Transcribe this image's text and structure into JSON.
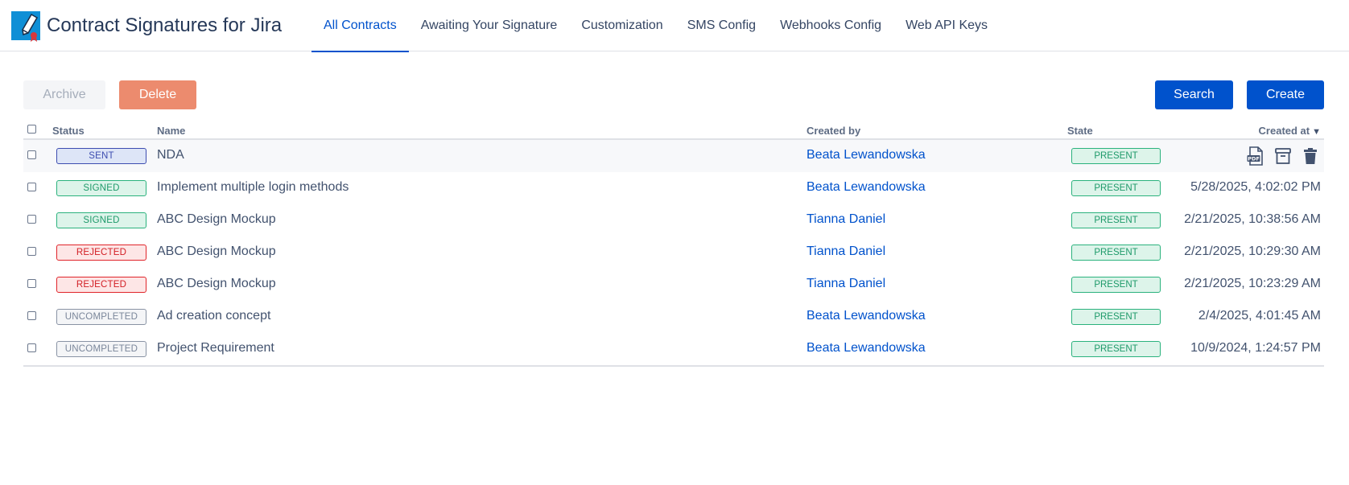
{
  "app": {
    "title": "Contract Signatures for Jira"
  },
  "nav": {
    "tabs": [
      {
        "label": "All Contracts",
        "active": true
      },
      {
        "label": "Awaiting Your Signature",
        "active": false
      },
      {
        "label": "Customization",
        "active": false
      },
      {
        "label": "SMS Config",
        "active": false
      },
      {
        "label": "Webhooks Config",
        "active": false
      },
      {
        "label": "Web API Keys",
        "active": false
      }
    ]
  },
  "toolbar": {
    "archive_label": "Archive",
    "delete_label": "Delete",
    "search_label": "Search",
    "create_label": "Create"
  },
  "table": {
    "headers": {
      "status": "Status",
      "name": "Name",
      "created_by": "Created by",
      "state": "State",
      "created_at": "Created at"
    },
    "sort_icon": "triangle-down-icon",
    "row_action_icons": [
      "pdf-file-icon",
      "archive-box-icon",
      "trash-icon"
    ],
    "rows": [
      {
        "status": "SENT",
        "status_kind": "sent",
        "name": "NDA",
        "created_by": "Beata Lewandowska",
        "state": "PRESENT",
        "created_at": "",
        "highlighted": true
      },
      {
        "status": "SIGNED",
        "status_kind": "signed",
        "name": "Implement multiple login methods",
        "created_by": "Beata Lewandowska",
        "state": "PRESENT",
        "created_at": "5/28/2025, 4:02:02 PM"
      },
      {
        "status": "SIGNED",
        "status_kind": "signed",
        "name": "ABC Design Mockup",
        "created_by": "Tianna Daniel",
        "state": "PRESENT",
        "created_at": "2/21/2025, 10:38:56 AM"
      },
      {
        "status": "REJECTED",
        "status_kind": "rejected",
        "name": "ABC Design Mockup",
        "created_by": "Tianna Daniel",
        "state": "PRESENT",
        "created_at": "2/21/2025, 10:29:30 AM"
      },
      {
        "status": "REJECTED",
        "status_kind": "rejected",
        "name": "ABC Design Mockup",
        "created_by": "Tianna Daniel",
        "state": "PRESENT",
        "created_at": "2/21/2025, 10:23:29 AM"
      },
      {
        "status": "UNCOMPLETED",
        "status_kind": "uncompleted",
        "name": "Ad creation concept",
        "created_by": "Beata Lewandowska",
        "state": "PRESENT",
        "created_at": "2/4/2025, 4:01:45 AM"
      },
      {
        "status": "UNCOMPLETED",
        "status_kind": "uncompleted",
        "name": "Project Requirement",
        "created_by": "Beata Lewandowska",
        "state": "PRESENT",
        "created_at": "10/9/2024, 1:24:57 PM"
      }
    ]
  }
}
